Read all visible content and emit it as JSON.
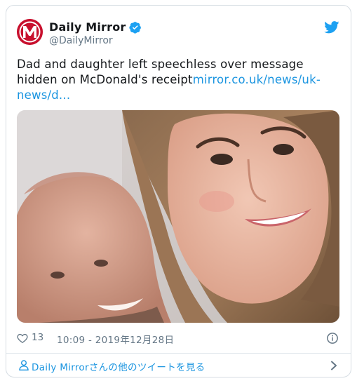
{
  "account": {
    "name": "Daily Mirror",
    "handle": "@DailyMirror",
    "verified": true,
    "avatar_icon": "daily-mirror-logo",
    "brand_color": "#c8102e"
  },
  "tweet": {
    "text": "Dad and daughter left speechless over message hidden on McDonald's receipt",
    "link_text": "mirror.co.uk/news/uk-news/d...",
    "link_color": "#1b95e0",
    "media_description_icon": "photo"
  },
  "meta": {
    "like_icon": "heart-icon",
    "likes": "13",
    "timestamp": "10:09 - 2019年12月28日",
    "info_icon": "info-icon"
  },
  "footer": {
    "icon": "user-icon",
    "label": "Daily Mirrorさんの他のツイートを見る",
    "chevron_icon": "chevron-right-icon"
  },
  "colors": {
    "text": "#14171a",
    "secondary": "#657786",
    "twitter_blue": "#1da1f2",
    "border": "#d6dde3"
  }
}
